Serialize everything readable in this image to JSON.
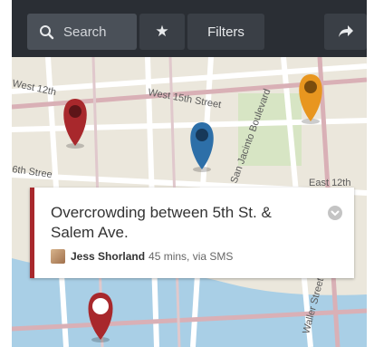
{
  "toolbar": {
    "search_label": "Search",
    "filters_label": "Filters",
    "icons": {
      "search": "search-icon",
      "favorites": "star-icon",
      "share": "share-icon"
    }
  },
  "map": {
    "street_labels": [
      "West 12th",
      "West 15th Street",
      "San Jacinto Boulevard",
      "East 12th",
      "6th Stree",
      "Waller Street"
    ],
    "pins": [
      {
        "color": "#a8282c",
        "icon": "map-pin-icon"
      },
      {
        "color": "#2d6fa8",
        "icon": "map-pin-icon"
      },
      {
        "color": "#e8961f",
        "icon": "map-pin-icon"
      },
      {
        "color": "#a8282c",
        "icon": "map-pin-selected-icon"
      }
    ]
  },
  "report": {
    "title": "Overcrowding between 5th St. & Salem Ave.",
    "author": "Jess Shorland",
    "meta": "45 mins, via SMS",
    "accent": "#a8282c"
  }
}
